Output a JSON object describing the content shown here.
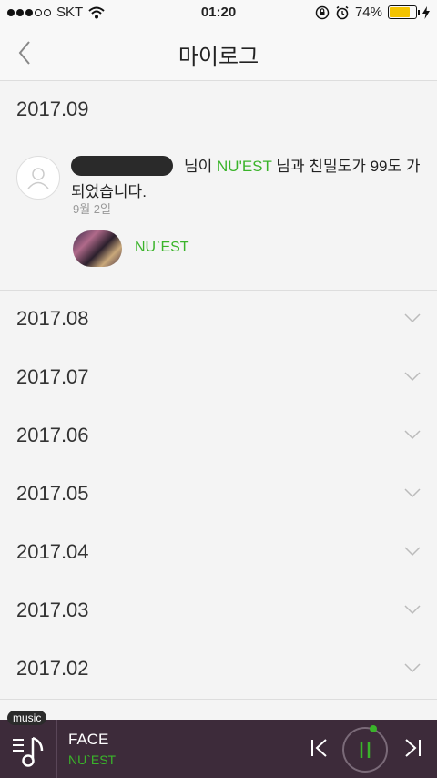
{
  "status": {
    "carrier": "SKT",
    "time": "01:20",
    "battery": "74%"
  },
  "header": {
    "title": "마이로그"
  },
  "expanded_month": {
    "label": "2017.09",
    "entry": {
      "msg_part1": "님이 ",
      "artist_highlight": "NU'EST",
      "msg_part2": " 님과 친밀도가 99도 가 되었습니다.",
      "date": "9월 2일",
      "artist_card_name": "NU`EST"
    }
  },
  "months": [
    "2017.08",
    "2017.07",
    "2017.06",
    "2017.05",
    "2017.04",
    "2017.03",
    "2017.02"
  ],
  "player": {
    "tag": "music",
    "song": "FACE",
    "artist": "NU`EST",
    "progress": 0.03
  },
  "colors": {
    "accent_green": "#3ab42a",
    "player_bg": "#3d2b3a",
    "battery": "#f3c300"
  }
}
